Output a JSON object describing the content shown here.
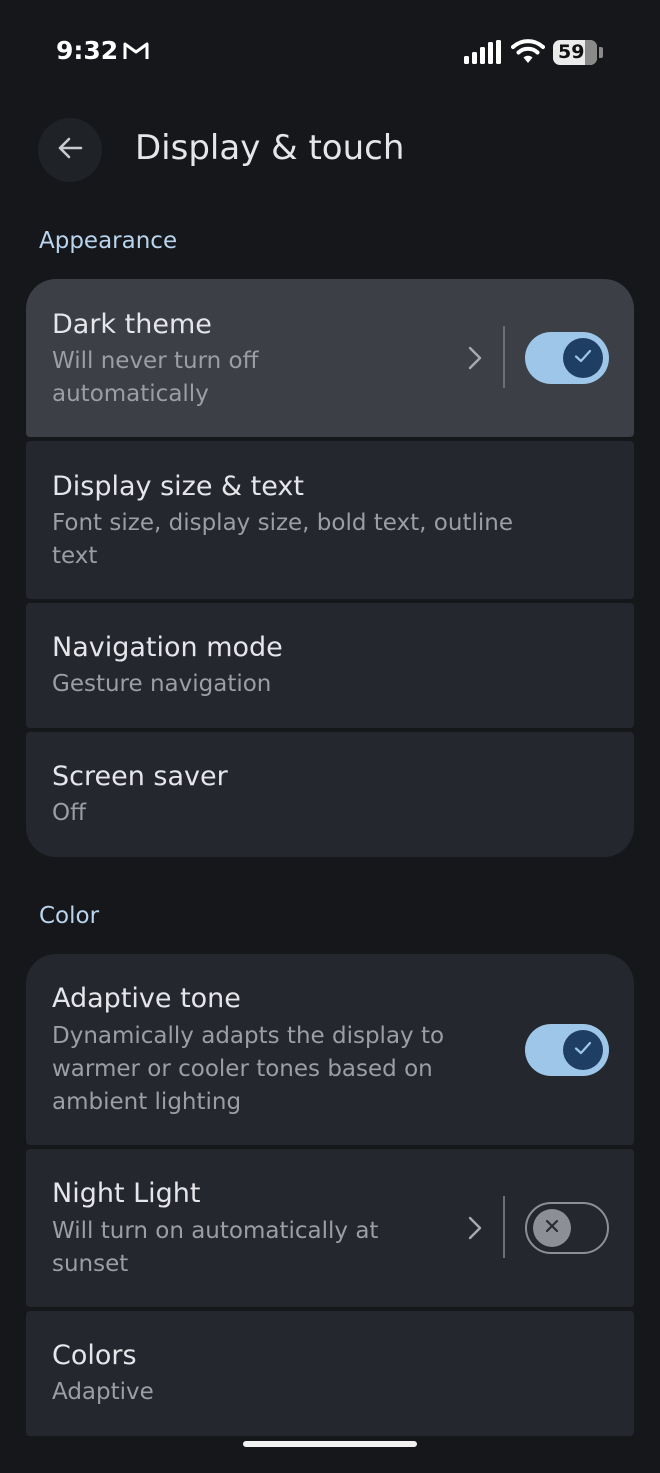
{
  "status_bar": {
    "time": "9:32",
    "battery": "59"
  },
  "header": {
    "title": "Display & touch"
  },
  "appearance": {
    "label": "Appearance",
    "items": [
      {
        "title": "Dark theme",
        "subtitle_lines": [
          "Will never turn off",
          "automatically"
        ],
        "toggle": "on"
      },
      {
        "title": "Display size & text",
        "subtitle_lines": [
          "Font size, display size, bold text, outline",
          "text"
        ]
      },
      {
        "title": "Navigation mode",
        "subtitle_lines": [
          "Gesture navigation"
        ]
      },
      {
        "title": "Screen saver",
        "subtitle_lines": [
          "Off"
        ]
      }
    ]
  },
  "color": {
    "label": "Color",
    "items": [
      {
        "title": "Adaptive tone",
        "subtitle_lines": [
          "Dynamically adapts the display to",
          "warmer or cooler tones based on",
          "ambient lighting"
        ],
        "toggle": "on"
      },
      {
        "title": "Night Light",
        "subtitle_lines": [
          "Will turn on automatically at",
          "sunset"
        ],
        "toggle": "off"
      },
      {
        "title": "Colors",
        "subtitle_lines": [
          "Adaptive"
        ]
      }
    ]
  },
  "icons": {
    "back": "arrow-back-icon",
    "chevron": "chevron-right-icon",
    "check": "check-icon",
    "close": "close-icon",
    "mail": "gmail-icon",
    "signal": "signal-icon",
    "wifi": "wifi-icon"
  },
  "colors": {
    "background": "#15171b",
    "card": "#24272d",
    "card_highlight": "#3c3f45",
    "accent": "#9ec6e8",
    "section_label": "#b9d4ec"
  }
}
